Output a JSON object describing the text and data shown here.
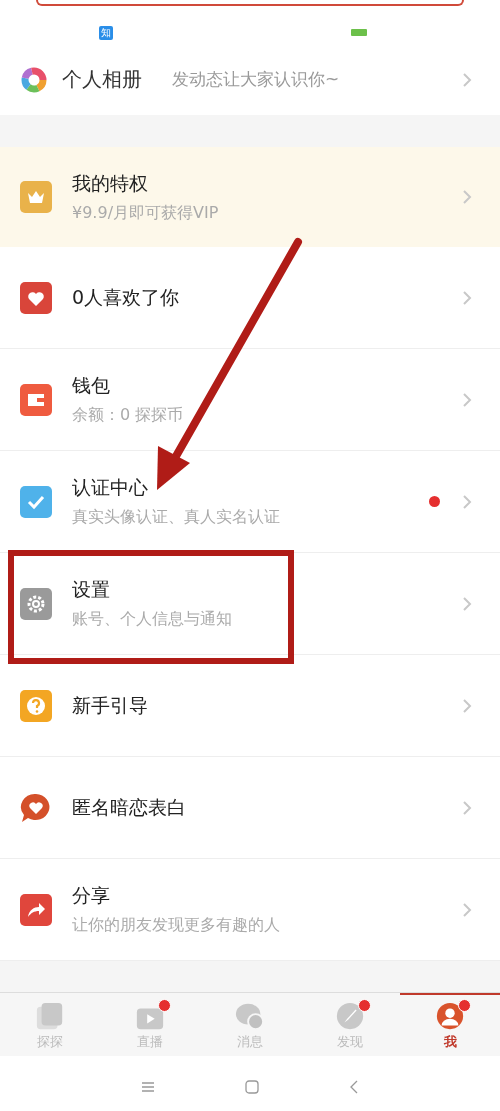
{
  "top_badges": [
    {
      "text": "知",
      "kind": "app"
    },
    {
      "kind": "battery"
    }
  ],
  "album": {
    "title": "个人相册",
    "subtitle": "发动态让大家认识你~"
  },
  "privilege": {
    "title": "我的特权",
    "subtitle": "¥9.9/月即可获得VIP"
  },
  "menu": [
    {
      "kind": "heart",
      "title": "0人喜欢了你",
      "notify": false
    },
    {
      "kind": "wallet",
      "title": "钱包",
      "subtitle": "余额：0 探探币",
      "notify": false
    },
    {
      "kind": "verify",
      "title": "认证中心",
      "subtitle": "真实头像认证、真人实名认证",
      "notify": true
    },
    {
      "kind": "settings",
      "title": "设置",
      "subtitle": "账号、个人信息与通知",
      "notify": false
    },
    {
      "kind": "guide",
      "title": "新手引导",
      "notify": false
    },
    {
      "kind": "confess",
      "title": "匿名暗恋表白",
      "notify": false
    },
    {
      "kind": "share",
      "title": "分享",
      "subtitle": "让你的朋友发现更多有趣的人",
      "notify": false
    }
  ],
  "tabs": [
    {
      "kind": "cards",
      "label": "探探",
      "selected": false,
      "badge": false
    },
    {
      "kind": "live",
      "label": "直播",
      "selected": false,
      "badge": true
    },
    {
      "kind": "chat",
      "label": "消息",
      "selected": false,
      "badge": false
    },
    {
      "kind": "discover",
      "label": "发现",
      "selected": false,
      "badge": true
    },
    {
      "kind": "me",
      "label": "我",
      "selected": true,
      "badge": true
    }
  ],
  "annotation": {
    "arrow": true,
    "highlight": true
  }
}
